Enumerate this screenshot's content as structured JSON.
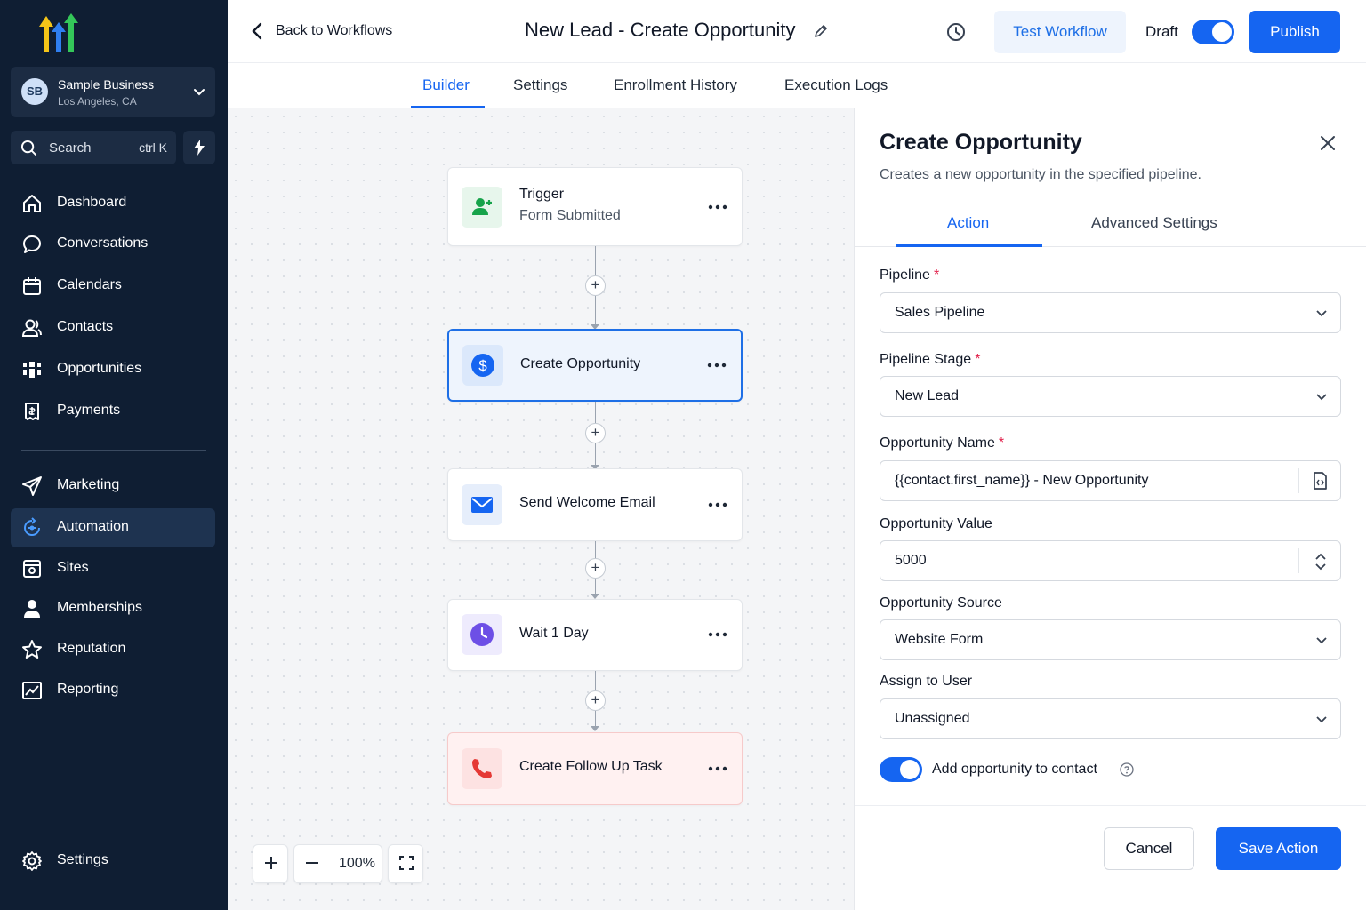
{
  "sidebar": {
    "account": {
      "initials": "SB",
      "name": "Sample Business",
      "location": "Los Angeles, CA"
    },
    "search": {
      "label": "Search",
      "shortcut": "ctrl K"
    },
    "nav": [
      {
        "label": "Dashboard",
        "icon": "home-icon"
      },
      {
        "label": "Conversations",
        "icon": "chat-icon"
      },
      {
        "label": "Calendars",
        "icon": "calendar-icon"
      },
      {
        "label": "Contacts",
        "icon": "contacts-icon"
      },
      {
        "label": "Opportunities",
        "icon": "opportunities-icon"
      },
      {
        "label": "Payments",
        "icon": "payments-icon"
      },
      {
        "label": "Marketing",
        "icon": "send-icon"
      },
      {
        "label": "Automation",
        "icon": "automation-icon",
        "active": true
      },
      {
        "label": "Sites",
        "icon": "sites-icon"
      },
      {
        "label": "Memberships",
        "icon": "user-icon"
      },
      {
        "label": "Reputation",
        "icon": "star-icon"
      },
      {
        "label": "Reporting",
        "icon": "chart-icon"
      }
    ],
    "settings_label": "Settings"
  },
  "header": {
    "back_label": "Back to Workflows",
    "title": "New Lead - Create Opportunity",
    "test_label": "Test Workflow",
    "draft_label": "Draft",
    "publish_label": "Publish"
  },
  "tabs": [
    "Builder",
    "Settings",
    "Enrollment History",
    "Execution Logs"
  ],
  "workflow": {
    "nodes": [
      {
        "title": "Trigger",
        "subtitle": "Form Submitted",
        "icon": "user-add-icon"
      },
      {
        "title": "Create Opportunity",
        "icon": "dollar-icon"
      },
      {
        "title": "Send Welcome Email",
        "icon": "mail-icon"
      },
      {
        "title": "Wait 1 Day",
        "icon": "clock-icon"
      },
      {
        "title": "Create Follow Up Task",
        "icon": "phone-icon"
      }
    ],
    "zoom": "100%"
  },
  "panel": {
    "title": "Create Opportunity",
    "description": "Creates a new opportunity in the specified pipeline.",
    "tabs": [
      "Action",
      "Advanced Settings"
    ],
    "fields": {
      "pipeline": {
        "label": "Pipeline",
        "value": "Sales Pipeline",
        "required": "*"
      },
      "stage": {
        "label": "Pipeline Stage",
        "value": "New Lead",
        "required": "*"
      },
      "name": {
        "label": "Opportunity Name",
        "value": "{{contact.first_name}} - New Opportunity",
        "required": "*"
      },
      "value": {
        "label": "Opportunity Value",
        "value": "5000"
      },
      "source": {
        "label": "Opportunity Source",
        "value": "Website Form"
      },
      "assign": {
        "label": "Assign to User",
        "value": "Unassigned"
      }
    },
    "toggle_label": "Add opportunity to contact",
    "cancel_label": "Cancel",
    "save_label": "Save Action"
  },
  "colors": {
    "accent": "#1565f1",
    "sidebar": "#0f1e33"
  }
}
